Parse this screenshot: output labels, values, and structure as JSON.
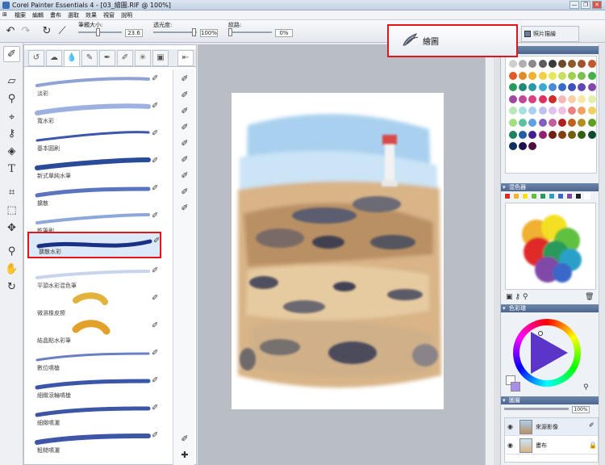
{
  "window": {
    "title": "Corel Painter Essentials 4 - [03_繪圖.RIF @ 100%]",
    "buttons": [
      "—",
      "❐",
      "✕"
    ]
  },
  "menu": [
    "檔案",
    "編輯",
    "畫布",
    "選取",
    "效果",
    "視窗",
    "說明"
  ],
  "property_bar": {
    "size_label": "筆觸大小:",
    "size_value": "23.6",
    "opacity_label": "透光度:",
    "opacity_value": "100%",
    "grain_label": "紋路:",
    "grain_value": "0%"
  },
  "mode_tabs": {
    "draw": "繪圖",
    "photo": "照片描繪"
  },
  "brush_categories": [
    "acrylic",
    "airbrush",
    "watercolor",
    "pencil",
    "pen",
    "chalk",
    "cloner",
    "blender"
  ],
  "brushes": [
    {
      "name": "淡彩",
      "color": "#8ea2d6",
      "selected": false
    },
    {
      "name": "寬水彩",
      "color": "#9eb0e0",
      "selected": false
    },
    {
      "name": "基本圓刷",
      "color": "#3d56a8",
      "selected": false
    },
    {
      "name": "新式單純水筆",
      "color": "#2a4a9a",
      "selected": false
    },
    {
      "name": "擴散",
      "color": "#5b74bf",
      "selected": false
    },
    {
      "name": "乾筆刷",
      "color": "#8ea8dc",
      "selected": false
    },
    {
      "name": "擴散水彩",
      "color": "#1b2f84",
      "selected": true
    },
    {
      "name": "平頭水彩混色筆",
      "color": "#c8d4ef",
      "selected": false
    },
    {
      "name": "微濕橡皮擦",
      "color": "#e3b23b",
      "selected": false
    },
    {
      "name": "結晶點水彩筆",
      "color": "#e3a12b",
      "selected": false
    },
    {
      "name": "數位噴槍",
      "color": "#6c7fc2",
      "selected": false
    },
    {
      "name": "細緻滾輪噴槍",
      "color": "#3b55a9",
      "selected": false
    },
    {
      "name": "細緻噴灑",
      "color": "#3d55a5",
      "selected": false
    },
    {
      "name": "粗糙噴灑",
      "color": "#3e56a8",
      "selected": false
    }
  ],
  "panels": {
    "color_sets": "",
    "mixer": "混色器",
    "color_wheel": "色彩環",
    "layers": "圖層",
    "layers_opacity": "100%",
    "layer_items": [
      "來源影像",
      "畫布"
    ]
  },
  "swatch_colors": [
    "#cfcfcf",
    "#b0b0b0",
    "#8a8a8a",
    "#5c5c5c",
    "#3a3a3a",
    "#6b4b2a",
    "#8b5a2b",
    "#a0522d",
    "#c05a2a",
    "#e05a2a",
    "#e08a2a",
    "#f0b030",
    "#f4d040",
    "#e7e85a",
    "#c8e060",
    "#a0d050",
    "#78c050",
    "#48b048",
    "#2a9a5a",
    "#208a7a",
    "#2a9aa8",
    "#3aa8d0",
    "#4a88d8",
    "#3a68c8",
    "#4050b8",
    "#6048b0",
    "#8048a8",
    "#a048a0",
    "#c04898",
    "#d84080",
    "#e03060",
    "#d02a2a",
    "#f2b8b8",
    "#f8d0a8",
    "#f8e8a8",
    "#e0f0a8",
    "#b8e8b8",
    "#a8e0e0",
    "#a8d0f0",
    "#c0c0f0",
    "#e0c0f0",
    "#f0c0e0",
    "#f08080",
    "#f0a060",
    "#f0d060",
    "#a0e080",
    "#60c0a0",
    "#60a0e0",
    "#8060c0",
    "#c060a0",
    "#b02020",
    "#c06020",
    "#b09020",
    "#60a020",
    "#208060",
    "#2060a0",
    "#402090",
    "#902070",
    "#702010",
    "#804010",
    "#706010",
    "#306010",
    "#104830",
    "#103060",
    "#201050",
    "#501040"
  ],
  "mixer_colors": [
    "#e02a2a",
    "#f0b030",
    "#f4e020",
    "#60c040",
    "#2a9a5a",
    "#2aa0c8",
    "#3a68c8",
    "#8048a8",
    "#222222",
    "#ffffff"
  ]
}
